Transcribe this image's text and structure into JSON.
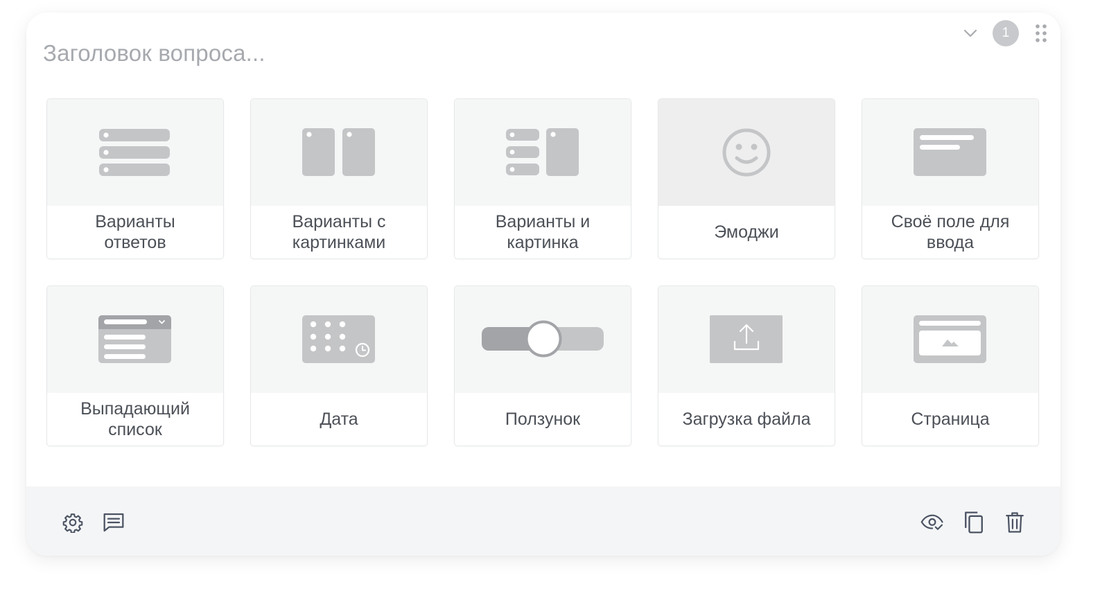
{
  "question": {
    "title_placeholder": "Заголовок вопроса...",
    "number_badge": "1"
  },
  "icons": {
    "collapse": "chevron-down-icon",
    "drag": "drag-handle-icon",
    "settings": "gear-icon",
    "comment": "comment-icon",
    "preview": "eye-check-icon",
    "copy": "copy-icon",
    "delete": "trash-icon"
  },
  "question_types": [
    {
      "lines": [
        "Варианты",
        "ответов"
      ],
      "icon": "options-list-icon"
    },
    {
      "lines": [
        "Варианты с",
        "картинками"
      ],
      "icon": "options-images-icon"
    },
    {
      "lines": [
        "Варианты и",
        "картинка"
      ],
      "icon": "options-and-image-icon"
    },
    {
      "lines": [
        "Эмоджи"
      ],
      "icon": "emoji-icon"
    },
    {
      "lines": [
        "Своё поле для",
        "ввода"
      ],
      "icon": "text-field-icon"
    },
    {
      "lines": [
        "Выпадающий",
        "список"
      ],
      "icon": "dropdown-icon"
    },
    {
      "lines": [
        "Дата"
      ],
      "icon": "date-icon"
    },
    {
      "lines": [
        "Ползунок"
      ],
      "icon": "slider-icon"
    },
    {
      "lines": [
        "Загрузка файла"
      ],
      "icon": "file-upload-icon"
    },
    {
      "lines": [
        "Страница"
      ],
      "icon": "page-icon"
    }
  ],
  "colors": {
    "icon_gray": "#c4c5c7",
    "text": "#4c5057",
    "placeholder": "#a6a9ae",
    "tile_bg": "#f5f6f6",
    "footer_bg": "#f4f5f6",
    "footer_icon": "#4b5363"
  }
}
